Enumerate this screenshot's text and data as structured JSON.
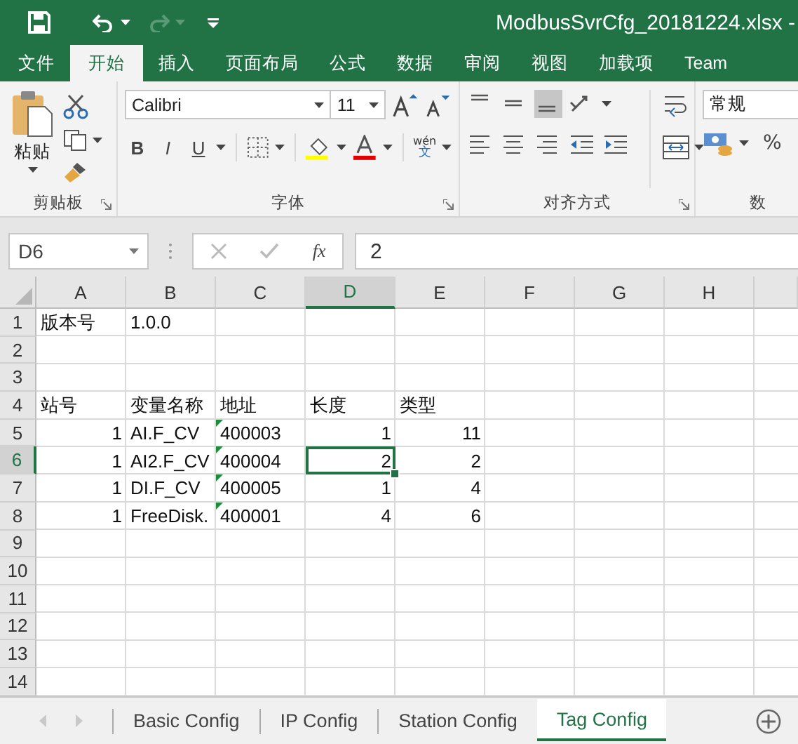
{
  "title_bar": {
    "title": "ModbusSvrCfg_20181224.xlsx -",
    "redo_disabled": true
  },
  "ribbon_tabs": [
    {
      "label": "文件",
      "selected": false
    },
    {
      "label": "开始",
      "selected": true
    },
    {
      "label": "插入",
      "selected": false
    },
    {
      "label": "页面布局",
      "selected": false
    },
    {
      "label": "公式",
      "selected": false
    },
    {
      "label": "数据",
      "selected": false
    },
    {
      "label": "审阅",
      "selected": false
    },
    {
      "label": "视图",
      "selected": false
    },
    {
      "label": "加载项",
      "selected": false
    },
    {
      "label": "Team",
      "selected": false
    }
  ],
  "ribbon": {
    "clipboard": {
      "label": "剪贴板",
      "paste_label": "粘贴"
    },
    "font": {
      "label": "字体",
      "font_name": "Calibri",
      "font_size": "11",
      "style_buttons": [
        {
          "label": "B",
          "kind": "bold"
        },
        {
          "label": "I",
          "kind": "italic"
        },
        {
          "label": "U",
          "kind": "underline"
        }
      ],
      "phonetic": {
        "top": "wén",
        "bottom": "文"
      }
    },
    "alignment": {
      "label": "对齐方式",
      "vertical_buttons": [
        {
          "kind": "top",
          "selected": false
        },
        {
          "kind": "middle",
          "selected": false
        },
        {
          "kind": "bottom",
          "selected": true
        }
      ]
    },
    "number": {
      "label": "数",
      "format": "常规",
      "percent": "%"
    }
  },
  "formula_bar": {
    "name_box": "D6",
    "fx": "fx",
    "value": "2"
  },
  "sheet": {
    "columns": [
      {
        "label": "A",
        "selected": false
      },
      {
        "label": "B",
        "selected": false
      },
      {
        "label": "C",
        "selected": false
      },
      {
        "label": "D",
        "selected": true
      },
      {
        "label": "E",
        "selected": false
      },
      {
        "label": "F",
        "selected": false
      },
      {
        "label": "G",
        "selected": false
      },
      {
        "label": "H",
        "selected": false
      }
    ],
    "rows": [
      {
        "header": "1",
        "selected": false,
        "cells": {
          "A": {
            "text": "版本号",
            "kind": "text",
            "flag": false,
            "selected": false
          },
          "B": {
            "text": "1.0.0",
            "kind": "text",
            "flag": false,
            "selected": false
          }
        }
      },
      {
        "header": "2",
        "selected": false,
        "cells": {}
      },
      {
        "header": "3",
        "selected": false,
        "cells": {}
      },
      {
        "header": "4",
        "selected": false,
        "cells": {
          "A": {
            "text": "站号",
            "kind": "text",
            "flag": false,
            "selected": false
          },
          "B": {
            "text": "变量名称",
            "kind": "text",
            "flag": false,
            "selected": false
          },
          "C": {
            "text": "地址",
            "kind": "text",
            "flag": false,
            "selected": false
          },
          "D": {
            "text": "长度",
            "kind": "text",
            "flag": false,
            "selected": false
          },
          "E": {
            "text": "类型",
            "kind": "text",
            "flag": false,
            "selected": false
          }
        }
      },
      {
        "header": "5",
        "selected": false,
        "cells": {
          "A": {
            "text": "1",
            "kind": "number",
            "flag": false,
            "selected": false
          },
          "B": {
            "text": "AI.F_CV",
            "kind": "text",
            "flag": false,
            "selected": false
          },
          "C": {
            "text": "400003",
            "kind": "text",
            "flag": true,
            "selected": false
          },
          "D": {
            "text": "1",
            "kind": "number",
            "flag": false,
            "selected": false
          },
          "E": {
            "text": "11",
            "kind": "number",
            "flag": false,
            "selected": false
          }
        }
      },
      {
        "header": "6",
        "selected": true,
        "cells": {
          "A": {
            "text": "1",
            "kind": "number",
            "flag": false,
            "selected": false
          },
          "B": {
            "text": "AI2.F_CV",
            "kind": "text",
            "flag": false,
            "selected": false
          },
          "C": {
            "text": "400004",
            "kind": "text",
            "flag": true,
            "selected": false
          },
          "D": {
            "text": "2",
            "kind": "number",
            "flag": false,
            "selected": true
          },
          "E": {
            "text": "2",
            "kind": "number",
            "flag": false,
            "selected": false
          }
        }
      },
      {
        "header": "7",
        "selected": false,
        "cells": {
          "A": {
            "text": "1",
            "kind": "number",
            "flag": false,
            "selected": false
          },
          "B": {
            "text": "DI.F_CV",
            "kind": "text",
            "flag": false,
            "selected": false
          },
          "C": {
            "text": "400005",
            "kind": "text",
            "flag": true,
            "selected": false
          },
          "D": {
            "text": "1",
            "kind": "number",
            "flag": false,
            "selected": false
          },
          "E": {
            "text": "4",
            "kind": "number",
            "flag": false,
            "selected": false
          }
        }
      },
      {
        "header": "8",
        "selected": false,
        "cells": {
          "A": {
            "text": "1",
            "kind": "number",
            "flag": false,
            "selected": false
          },
          "B": {
            "text": "FreeDisk.",
            "kind": "text",
            "flag": false,
            "selected": false
          },
          "C": {
            "text": "400001",
            "kind": "text",
            "flag": true,
            "selected": false
          },
          "D": {
            "text": "4",
            "kind": "number",
            "flag": false,
            "selected": false
          },
          "E": {
            "text": "6",
            "kind": "number",
            "flag": false,
            "selected": false
          }
        }
      },
      {
        "header": "9",
        "selected": false,
        "cells": {}
      },
      {
        "header": "10",
        "selected": false,
        "cells": {}
      },
      {
        "header": "11",
        "selected": false,
        "cells": {}
      },
      {
        "header": "12",
        "selected": false,
        "cells": {}
      },
      {
        "header": "13",
        "selected": false,
        "cells": {}
      },
      {
        "header": "14",
        "selected": false,
        "cells": {}
      }
    ]
  },
  "sheet_tabs": [
    {
      "label": "Basic Config",
      "selected": false
    },
    {
      "label": "IP Config",
      "selected": false
    },
    {
      "label": "Station Config",
      "selected": false
    },
    {
      "label": "Tag Config",
      "selected": true
    }
  ]
}
